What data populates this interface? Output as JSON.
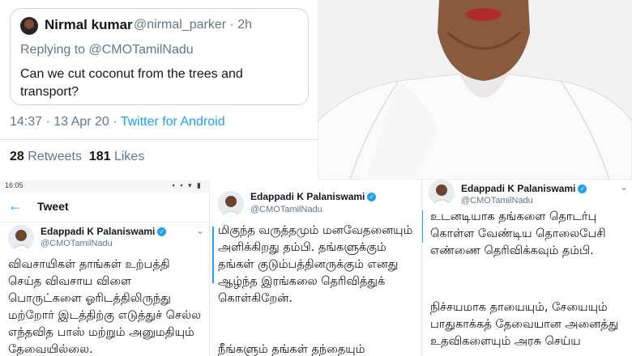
{
  "reply_tweet": {
    "name": "Nirmal kumar",
    "handle_time": "@nirmal_parker · 2h",
    "replying_to": "Replying to @CMOTamilNadu",
    "text": "Can we cut coconut from the trees and transport?",
    "timestamp": "14:37 · 13 Apr 20 · ",
    "source": "Twitter for Android",
    "retweets_count": "28",
    "retweets_label": " Retweets  ",
    "likes_count": "181",
    "likes_label": " Likes"
  },
  "panel1": {
    "status_time": "16:05",
    "header_title": "Tweet",
    "author_name": "Edappadi K Palaniswami",
    "author_handle": "@CMOTamilNadu",
    "text": "விவசாயிகள் தாங்கள் உற்பத்தி செய்த விவசாய விளை பொருட்களை ஓரிடத்திலிருந்து மற்றோர் இடத்திற்கு எடுத்துச் செல்ல எந்தவித பாஸ் மற்றும் அனுமதியும் தேவையில்லை."
  },
  "panel2": {
    "author_name": "Edappadi K Palaniswami",
    "author_handle": "@CMOTamilNadu",
    "text": "மிகுந்த வருத்தமும் மனவேதனையும் அளிக்கிறது தம்பி. தங்களுக்கும் தங்கள் குடும்பத்தினருக்கும் எனது ஆழ்ந்த இரங்கலை தெரிவித்துக் கொள்கிறேன்.",
    "text2": "நீங்களும் தங்கள் தந்தையும்"
  },
  "panel3": {
    "author_name": "Edappadi K Palaniswami",
    "author_handle": "@CMOTamilNadu",
    "text": "உடனடியாக தங்களை தொடர்பு கொள்ள வேண்டிய தொலைபேசி எண்ணை தெரிவிக்கவும் தம்பி.",
    "text2": "நிச்சயமாக தாயையும், சேயையும் பாதுகாக்கத் தேவையான அனைத்து உதவிகளையும் அரசு செய்ய"
  },
  "colors": {
    "twitter_blue": "#1da1f2",
    "muted": "#657786",
    "border": "#ccd6dd"
  },
  "icons": [
    "back-arrow-icon",
    "verified-badge-icon",
    "chevron-down-icon",
    "status-icons"
  ]
}
